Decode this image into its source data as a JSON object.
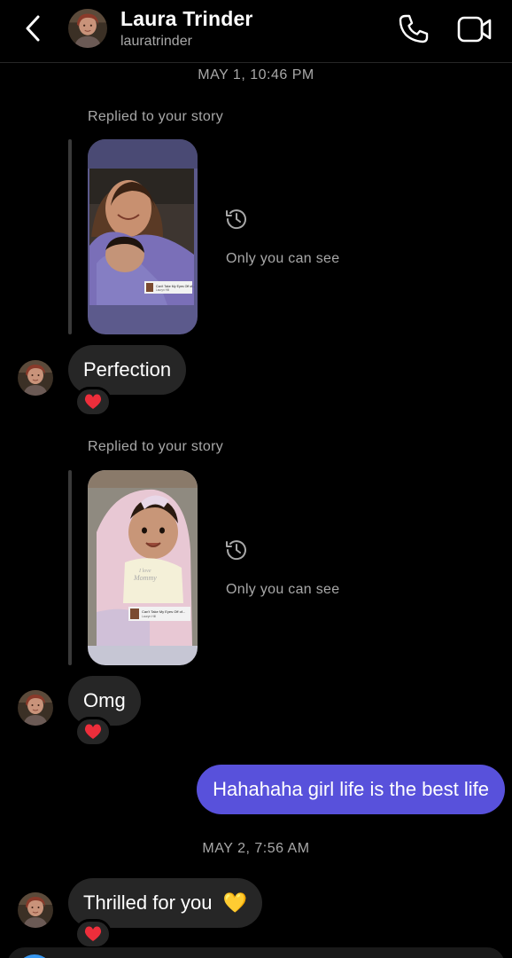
{
  "header": {
    "name": "Laura Trinder",
    "username": "lauratrinder"
  },
  "thread": {
    "timestamp_1": "MAY 1, 10:46 PM",
    "story_reply_1": {
      "caption": "Replied to your story",
      "visibility": "Only you can see",
      "sticker_title": "Can't Take My Eyes Off of...",
      "sticker_artist": "Lauryn Hill"
    },
    "message_1": {
      "text": "Perfection",
      "reaction": "❤️"
    },
    "story_reply_2": {
      "caption": "Replied to your story",
      "visibility": "Only you can see",
      "sticker_title": "Can't Take My Eyes Off of...",
      "sticker_artist": "Lauryn Hill"
    },
    "message_2": {
      "text": "Omg",
      "reaction": "❤️"
    },
    "message_3": {
      "text": "Hahahaha girl life is the best life"
    },
    "timestamp_2": "MAY 2, 7:56 AM",
    "message_4": {
      "text": "Thrilled for you",
      "emoji": "💛",
      "reaction": "❤️"
    }
  },
  "colors": {
    "background": "#000000",
    "incoming_bubble": "#262626",
    "outgoing_bubble": "#5851db",
    "secondary_text": "#a8a8a8"
  },
  "icons": [
    "chevron-left-icon",
    "phone-icon",
    "video-camera-icon",
    "history-icon",
    "heart-icon"
  ]
}
